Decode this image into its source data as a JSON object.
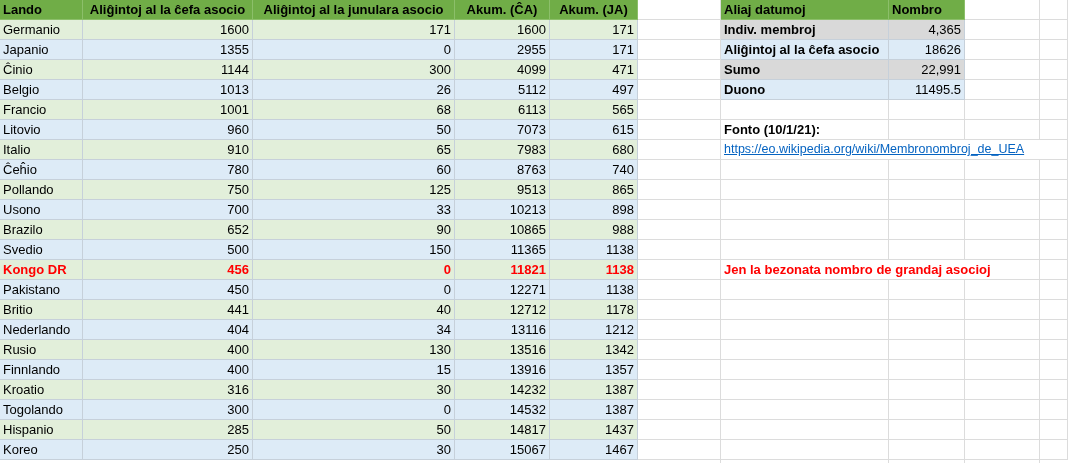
{
  "main_table": {
    "columns": [
      "Lando",
      "Aliĝintoj al la ĉefa asocio",
      "Aliĝintoj al la junulara asocio",
      "Akum. (ĈA)",
      "Akum. (JA)"
    ],
    "rows": [
      {
        "cells": [
          "Germanio",
          "1600",
          "171",
          "1600",
          "171"
        ],
        "highlighted": false
      },
      {
        "cells": [
          "Japanio",
          "1355",
          "0",
          "2955",
          "171"
        ],
        "highlighted": false
      },
      {
        "cells": [
          "Ĉinio",
          "1144",
          "300",
          "4099",
          "471"
        ],
        "highlighted": false
      },
      {
        "cells": [
          "Belgio",
          "1013",
          "26",
          "5112",
          "497"
        ],
        "highlighted": false
      },
      {
        "cells": [
          "Francio",
          "1001",
          "68",
          "6113",
          "565"
        ],
        "highlighted": false
      },
      {
        "cells": [
          "Litovio",
          "960",
          "50",
          "7073",
          "615"
        ],
        "highlighted": false
      },
      {
        "cells": [
          "Italio",
          "910",
          "65",
          "7983",
          "680"
        ],
        "highlighted": false
      },
      {
        "cells": [
          "Ĉeĥio",
          "780",
          "60",
          "8763",
          "740"
        ],
        "highlighted": false
      },
      {
        "cells": [
          "Pollando",
          "750",
          "125",
          "9513",
          "865"
        ],
        "highlighted": false
      },
      {
        "cells": [
          "Usono",
          "700",
          "33",
          "10213",
          "898"
        ],
        "highlighted": false
      },
      {
        "cells": [
          "Brazilo",
          "652",
          "90",
          "10865",
          "988"
        ],
        "highlighted": false
      },
      {
        "cells": [
          "Svedio",
          "500",
          "150",
          "11365",
          "1138"
        ],
        "highlighted": false
      },
      {
        "cells": [
          "Kongo DR",
          "456",
          "0",
          "11821",
          "1138"
        ],
        "highlighted": true
      },
      {
        "cells": [
          "Pakistano",
          "450",
          "0",
          "12271",
          "1138"
        ],
        "highlighted": false
      },
      {
        "cells": [
          "Britio",
          "441",
          "40",
          "12712",
          "1178"
        ],
        "highlighted": false
      },
      {
        "cells": [
          "Nederlando",
          "404",
          "34",
          "13116",
          "1212"
        ],
        "highlighted": false
      },
      {
        "cells": [
          "Rusio",
          "400",
          "130",
          "13516",
          "1342"
        ],
        "highlighted": false
      },
      {
        "cells": [
          "Finnlando",
          "400",
          "15",
          "13916",
          "1357"
        ],
        "highlighted": false
      },
      {
        "cells": [
          "Kroatio",
          "316",
          "30",
          "14232",
          "1387"
        ],
        "highlighted": false
      },
      {
        "cells": [
          "Togolando",
          "300",
          "0",
          "14532",
          "1387"
        ],
        "highlighted": false
      },
      {
        "cells": [
          "Hispanio",
          "285",
          "50",
          "14817",
          "1437"
        ],
        "highlighted": false
      },
      {
        "cells": [
          "Koreo",
          "250",
          "30",
          "15067",
          "1467"
        ],
        "highlighted": false
      }
    ]
  },
  "summary_table": {
    "columns": [
      "Aliaj datumoj",
      "Nombro"
    ],
    "rows": [
      {
        "label": "Indiv. membroj",
        "value": "4,365",
        "shaded": true
      },
      {
        "label": "Aliĝintoj al la ĉefa asocio",
        "value": "18626",
        "shaded": false
      },
      {
        "label": "Sumo",
        "value": "22,991",
        "shaded": true
      },
      {
        "label": "Duono",
        "value": "11495.5",
        "shaded": false
      }
    ]
  },
  "source": {
    "label": "Fonto (10/1/21):",
    "link": "https://eo.wikipedia.org/wiki/Membronombroj_de_UEA"
  },
  "note": "Jen la bezonata nombro de grandaj asocioj"
}
